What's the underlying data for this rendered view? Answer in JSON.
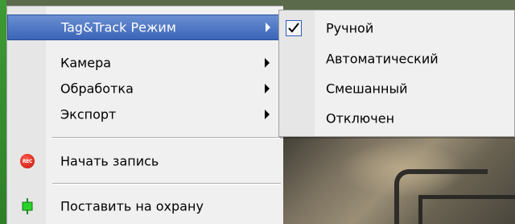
{
  "menu": {
    "items": [
      {
        "label": "Tag&Track Режим",
        "has_submenu": true,
        "active": true
      },
      {
        "label": "Камера",
        "has_submenu": true
      },
      {
        "label": "Обработка",
        "has_submenu": true
      },
      {
        "label": "Экспорт",
        "has_submenu": true
      },
      {
        "label": "Начать запись",
        "icon": "rec-icon"
      },
      {
        "label": "Поставить на охрану",
        "icon": "guard-icon"
      }
    ],
    "rec_icon_text": "REC"
  },
  "submenu": {
    "items": [
      {
        "label": "Ручной",
        "checked": true
      },
      {
        "label": "Автоматический",
        "checked": false
      },
      {
        "label": "Смешанный",
        "checked": false
      },
      {
        "label": "Отключен",
        "checked": false
      }
    ]
  },
  "colors": {
    "highlight": "#3b64b8",
    "menu_bg": "#f0f0f0",
    "rec_red": "#c4130b",
    "guard_green": "#2bd12b"
  }
}
